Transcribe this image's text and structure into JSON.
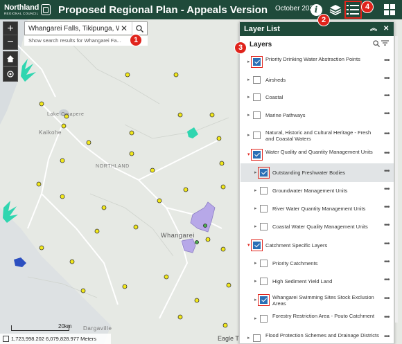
{
  "header": {
    "logo_main": "Northland",
    "logo_sub": "REGIONAL COUNCIL",
    "title": "Proposed Regional Plan - Appeals Version",
    "date": "October 2021",
    "buttons": [
      {
        "icon": "info-icon"
      },
      {
        "icon": "layers-icon"
      },
      {
        "icon": "layer-list-icon"
      },
      {
        "icon": "grid-icon"
      }
    ],
    "callouts": [
      "2",
      "4"
    ]
  },
  "search": {
    "value": "Whangarei Falls, Tikipunga, Wha",
    "hint": "Show search results for Whangarei Fa...",
    "callout": "1"
  },
  "map": {
    "place_labels": [
      "Lake Omapere",
      "Kaikohe",
      "NORTHLAND",
      "Whangarei",
      "Dargaville"
    ],
    "scale_label": "20km",
    "coordinates": "1,723,998.202 6,079,828.977 Meters",
    "attribution": "Eagle T",
    "zoom_in": "+",
    "zoom_out": "−"
  },
  "panel": {
    "title": "Layer List",
    "section_title": "Layers",
    "callout": "3",
    "layers": [
      {
        "label": "Priority Drinking Water Abstraction Points",
        "checked": true,
        "level": 0,
        "expand": "collapsed"
      },
      {
        "label": "Airsheds",
        "checked": false,
        "level": 0,
        "expand": "collapsed"
      },
      {
        "label": "Coastal",
        "checked": false,
        "level": 0,
        "expand": "collapsed"
      },
      {
        "label": "Marine Pathways",
        "checked": false,
        "level": 0,
        "expand": "none"
      },
      {
        "label": "Natural, Historic and Cultural Heritage - Fresh and Coastal Waters",
        "checked": false,
        "level": 0,
        "expand": "collapsed"
      },
      {
        "label": "Water Quality and Quantity Management Units",
        "checked": true,
        "level": 0,
        "expand": "expanded"
      },
      {
        "label": "Outstanding Freshwater Bodies",
        "checked": true,
        "level": 1,
        "expand": "collapsed"
      },
      {
        "label": "Groundwater Management Units",
        "checked": false,
        "level": 1,
        "expand": "collapsed"
      },
      {
        "label": "River Water Quantity Management Units",
        "checked": false,
        "level": 1,
        "expand": "collapsed"
      },
      {
        "label": "Coastal Water Quality Management Units",
        "checked": false,
        "level": 1,
        "expand": "collapsed"
      },
      {
        "label": "Catchment Specific Layers",
        "checked": true,
        "level": 0,
        "expand": "expanded"
      },
      {
        "label": "Priority Catchments",
        "checked": false,
        "level": 1,
        "expand": "collapsed"
      },
      {
        "label": "High Sediment Yield Land",
        "checked": false,
        "level": 1,
        "expand": "none"
      },
      {
        "label": "Whangarei Swimming Sites Stock Exclusion Areas",
        "checked": true,
        "level": 1,
        "expand": "collapsed"
      },
      {
        "label": "Forestry Restriction Area - Pouto Catchment",
        "checked": false,
        "level": 1,
        "expand": "none"
      },
      {
        "label": "Flood Protection Schemes and Drainage Districts",
        "checked": false,
        "level": 0,
        "expand": "collapsed"
      }
    ]
  },
  "colors": {
    "header_bg": "#1f4a3a",
    "callout_red": "#e0231b",
    "checkbox_blue": "#2a6fb6",
    "point_yellow": "#f2e81a",
    "polygon_purple": "#b7a8e8",
    "cyan_feature": "#2fd6b0"
  }
}
